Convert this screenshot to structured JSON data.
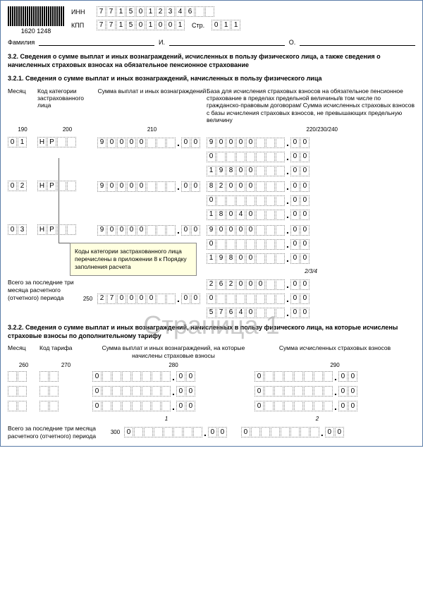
{
  "header": {
    "barcode_num": "1620 1248",
    "inn_label": "ИНН",
    "inn": [
      "7",
      "7",
      "1",
      "5",
      "0",
      "1",
      "2",
      "3",
      "4",
      "6",
      "",
      ""
    ],
    "kpp_label": "КПП",
    "kpp": [
      "7",
      "7",
      "1",
      "5",
      "0",
      "1",
      "0",
      "0",
      "1"
    ],
    "page_label": "Стр.",
    "page_num": [
      "0",
      "1",
      "1"
    ]
  },
  "familia": {
    "label": "Фамилия",
    "i": "И.",
    "o": "О."
  },
  "section_32": "3.2. Сведения о сумме выплат и иных вознаграждений, исчисленных в пользу физического лица, а также сведения о начисленных страховых взносах на обязательное пенсионное страхование",
  "section_321": "3.2.1. Сведения о сумме выплат и иных вознаграждений, начисленных в пользу физического лица",
  "headers_321": {
    "mes": "Месяц",
    "code": "Код категории застрахованного лица",
    "sum": "Сумма выплат и иных вознаграждений",
    "base": "База для исчисления страховых взносов на обязательное пенсионное страхование в пределах предельной величины/в том числе по гражданско-правовым договорам/ Сумма исчисленных страховых взносов с базы исчисления страховых взносов, не превышающих предельную величину"
  },
  "colnums_321": {
    "c1": "190",
    "c2": "200",
    "c3": "210",
    "c4": "220/230/240"
  },
  "rows_321": [
    {
      "mes": [
        "0",
        "1"
      ],
      "code": [
        "Н",
        "Р",
        "",
        ""
      ],
      "amt": [
        "9",
        "0",
        "0",
        "0",
        "0",
        "",
        "",
        ""
      ],
      "amt_dec": [
        "0",
        "0"
      ],
      "bases": [
        {
          "v": [
            "9",
            "0",
            "0",
            "0",
            "0",
            "",
            "",
            ""
          ],
          "d": [
            "0",
            "0"
          ]
        },
        {
          "v": [
            "0",
            "",
            "",
            "",
            "",
            "",
            "",
            ""
          ],
          "d": [
            "0",
            "0"
          ]
        },
        {
          "v": [
            "1",
            "9",
            "8",
            "0",
            "0",
            "",
            "",
            ""
          ],
          "d": [
            "0",
            "0"
          ]
        }
      ]
    },
    {
      "mes": [
        "0",
        "2"
      ],
      "code": [
        "Н",
        "Р",
        "",
        ""
      ],
      "amt": [
        "9",
        "0",
        "0",
        "0",
        "0",
        "",
        "",
        ""
      ],
      "amt_dec": [
        "0",
        "0"
      ],
      "bases": [
        {
          "v": [
            "8",
            "2",
            "0",
            "0",
            "0",
            "",
            "",
            ""
          ],
          "d": [
            "0",
            "0"
          ]
        },
        {
          "v": [
            "0",
            "",
            "",
            "",
            "",
            "",
            "",
            ""
          ],
          "d": [
            "0",
            "0"
          ]
        },
        {
          "v": [
            "1",
            "8",
            "0",
            "4",
            "0",
            "",
            "",
            ""
          ],
          "d": [
            "0",
            "0"
          ]
        }
      ]
    },
    {
      "mes": [
        "0",
        "3"
      ],
      "code": [
        "Н",
        "Р",
        "",
        ""
      ],
      "amt": [
        "9",
        "0",
        "0",
        "0",
        "0",
        "",
        "",
        ""
      ],
      "amt_dec": [
        "0",
        "0"
      ],
      "bases": [
        {
          "v": [
            "9",
            "0",
            "0",
            "0",
            "0",
            "",
            "",
            ""
          ],
          "d": [
            "0",
            "0"
          ]
        },
        {
          "v": [
            "0",
            "",
            "",
            "",
            "",
            "",
            "",
            ""
          ],
          "d": [
            "0",
            "0"
          ]
        },
        {
          "v": [
            "1",
            "9",
            "8",
            "0",
            "0",
            "",
            "",
            ""
          ],
          "d": [
            "0",
            "0"
          ]
        }
      ]
    }
  ],
  "subnums": {
    "a": "1",
    "b": "2/3/4"
  },
  "total_321": {
    "label": "Всего за последние три месяца расчетного (отчетного) периода",
    "num": "250",
    "amt": [
      "2",
      "7",
      "0",
      "0",
      "0",
      "0",
      "",
      ""
    ],
    "amt_dec": [
      "0",
      "0"
    ],
    "bases": [
      {
        "v": [
          "2",
          "6",
          "2",
          "0",
          "0",
          "0",
          "",
          ""
        ],
        "d": [
          "0",
          "0"
        ]
      },
      {
        "v": [
          "0",
          "",
          "",
          "",
          "",
          "",
          "",
          ""
        ],
        "d": [
          "0",
          "0"
        ]
      },
      {
        "v": [
          "5",
          "7",
          "6",
          "4",
          "0",
          "",
          "",
          ""
        ],
        "d": [
          "0",
          "0"
        ]
      }
    ]
  },
  "tooltip": "Коды категории застрахованного лица перечислены в приложении 8 к Порядку заполнения расчета",
  "watermark": "Страница 1",
  "section_322": "3.2.2. Сведения о сумме выплат и иных вознаграждений, начисленных в пользу физического лица, на которые исчислены страховые взносы по дополнительному тарифу",
  "headers_322": {
    "mes": "Месяц",
    "code": "Код тарифа",
    "amt": "Сумма выплат и иных вознаграждений, на которые начислены страховые взносы",
    "sum": "Сумма исчисленных страховых взносов"
  },
  "colnums_322": {
    "c1": "260",
    "c2": "270",
    "c3": "280",
    "c4": "290"
  },
  "rows_322": [
    {
      "mes": [
        "",
        ""
      ],
      "code": [
        "",
        ""
      ],
      "amt": [
        "0",
        "",
        "",
        "",
        "",
        "",
        "",
        ""
      ],
      "amt_dec": [
        "0",
        "0"
      ],
      "sum": [
        "0",
        "",
        "",
        "",
        "",
        "",
        "",
        ""
      ],
      "sum_dec": [
        "0",
        "0"
      ]
    },
    {
      "mes": [
        "",
        ""
      ],
      "code": [
        "",
        ""
      ],
      "amt": [
        "0",
        "",
        "",
        "",
        "",
        "",
        "",
        ""
      ],
      "amt_dec": [
        "0",
        "0"
      ],
      "sum": [
        "0",
        "",
        "",
        "",
        "",
        "",
        "",
        ""
      ],
      "sum_dec": [
        "0",
        "0"
      ]
    },
    {
      "mes": [
        "",
        ""
      ],
      "code": [
        "",
        ""
      ],
      "amt": [
        "0",
        "",
        "",
        "",
        "",
        "",
        "",
        ""
      ],
      "amt_dec": [
        "0",
        "0"
      ],
      "sum": [
        "0",
        "",
        "",
        "",
        "",
        "",
        "",
        ""
      ],
      "sum_dec": [
        "0",
        "0"
      ]
    }
  ],
  "sub322": {
    "a": "1",
    "b": "2"
  },
  "total_322": {
    "label": "Всего за последние три месяца расчетного (отчетного) периода",
    "num": "300",
    "amt": [
      "0",
      "",
      "",
      "",
      "",
      "",
      "",
      ""
    ],
    "amt_dec": [
      "0",
      "0"
    ],
    "sum": [
      "0",
      "",
      "",
      "",
      "",
      "",
      "",
      ""
    ],
    "sum_dec": [
      "0",
      "0"
    ]
  }
}
